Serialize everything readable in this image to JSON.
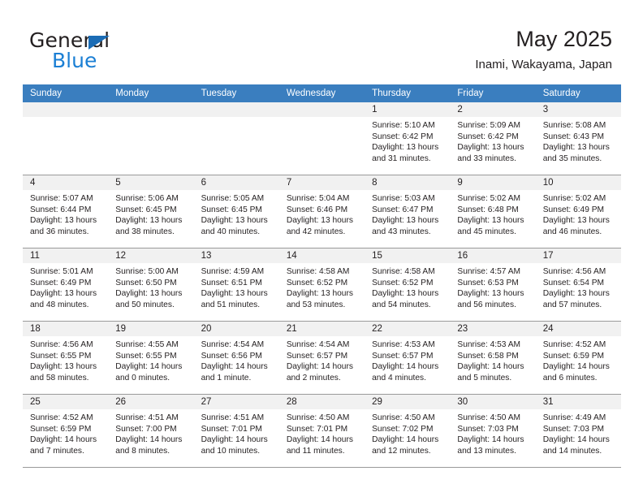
{
  "brand": {
    "name_top": "General",
    "name_bottom": "Blue",
    "accent_color": "#1b7fd4",
    "triangle_color": "#1b6cb5"
  },
  "header": {
    "title": "May 2025",
    "subtitle": "Inami, Wakayama, Japan"
  },
  "calendar": {
    "header_bg": "#3a7ebf",
    "daynum_band_bg": "#f1f1f1",
    "weekdays": [
      "Sunday",
      "Monday",
      "Tuesday",
      "Wednesday",
      "Thursday",
      "Friday",
      "Saturday"
    ],
    "weeks": [
      [
        {
          "day": "",
          "empty": true
        },
        {
          "day": "",
          "empty": true
        },
        {
          "day": "",
          "empty": true
        },
        {
          "day": "",
          "empty": true
        },
        {
          "day": "1",
          "sunrise": "Sunrise: 5:10 AM",
          "sunset": "Sunset: 6:42 PM",
          "daylight1": "Daylight: 13 hours",
          "daylight2": "and 31 minutes."
        },
        {
          "day": "2",
          "sunrise": "Sunrise: 5:09 AM",
          "sunset": "Sunset: 6:42 PM",
          "daylight1": "Daylight: 13 hours",
          "daylight2": "and 33 minutes."
        },
        {
          "day": "3",
          "sunrise": "Sunrise: 5:08 AM",
          "sunset": "Sunset: 6:43 PM",
          "daylight1": "Daylight: 13 hours",
          "daylight2": "and 35 minutes."
        }
      ],
      [
        {
          "day": "4",
          "sunrise": "Sunrise: 5:07 AM",
          "sunset": "Sunset: 6:44 PM",
          "daylight1": "Daylight: 13 hours",
          "daylight2": "and 36 minutes."
        },
        {
          "day": "5",
          "sunrise": "Sunrise: 5:06 AM",
          "sunset": "Sunset: 6:45 PM",
          "daylight1": "Daylight: 13 hours",
          "daylight2": "and 38 minutes."
        },
        {
          "day": "6",
          "sunrise": "Sunrise: 5:05 AM",
          "sunset": "Sunset: 6:45 PM",
          "daylight1": "Daylight: 13 hours",
          "daylight2": "and 40 minutes."
        },
        {
          "day": "7",
          "sunrise": "Sunrise: 5:04 AM",
          "sunset": "Sunset: 6:46 PM",
          "daylight1": "Daylight: 13 hours",
          "daylight2": "and 42 minutes."
        },
        {
          "day": "8",
          "sunrise": "Sunrise: 5:03 AM",
          "sunset": "Sunset: 6:47 PM",
          "daylight1": "Daylight: 13 hours",
          "daylight2": "and 43 minutes."
        },
        {
          "day": "9",
          "sunrise": "Sunrise: 5:02 AM",
          "sunset": "Sunset: 6:48 PM",
          "daylight1": "Daylight: 13 hours",
          "daylight2": "and 45 minutes."
        },
        {
          "day": "10",
          "sunrise": "Sunrise: 5:02 AM",
          "sunset": "Sunset: 6:49 PM",
          "daylight1": "Daylight: 13 hours",
          "daylight2": "and 46 minutes."
        }
      ],
      [
        {
          "day": "11",
          "sunrise": "Sunrise: 5:01 AM",
          "sunset": "Sunset: 6:49 PM",
          "daylight1": "Daylight: 13 hours",
          "daylight2": "and 48 minutes."
        },
        {
          "day": "12",
          "sunrise": "Sunrise: 5:00 AM",
          "sunset": "Sunset: 6:50 PM",
          "daylight1": "Daylight: 13 hours",
          "daylight2": "and 50 minutes."
        },
        {
          "day": "13",
          "sunrise": "Sunrise: 4:59 AM",
          "sunset": "Sunset: 6:51 PM",
          "daylight1": "Daylight: 13 hours",
          "daylight2": "and 51 minutes."
        },
        {
          "day": "14",
          "sunrise": "Sunrise: 4:58 AM",
          "sunset": "Sunset: 6:52 PM",
          "daylight1": "Daylight: 13 hours",
          "daylight2": "and 53 minutes."
        },
        {
          "day": "15",
          "sunrise": "Sunrise: 4:58 AM",
          "sunset": "Sunset: 6:52 PM",
          "daylight1": "Daylight: 13 hours",
          "daylight2": "and 54 minutes."
        },
        {
          "day": "16",
          "sunrise": "Sunrise: 4:57 AM",
          "sunset": "Sunset: 6:53 PM",
          "daylight1": "Daylight: 13 hours",
          "daylight2": "and 56 minutes."
        },
        {
          "day": "17",
          "sunrise": "Sunrise: 4:56 AM",
          "sunset": "Sunset: 6:54 PM",
          "daylight1": "Daylight: 13 hours",
          "daylight2": "and 57 minutes."
        }
      ],
      [
        {
          "day": "18",
          "sunrise": "Sunrise: 4:56 AM",
          "sunset": "Sunset: 6:55 PM",
          "daylight1": "Daylight: 13 hours",
          "daylight2": "and 58 minutes."
        },
        {
          "day": "19",
          "sunrise": "Sunrise: 4:55 AM",
          "sunset": "Sunset: 6:55 PM",
          "daylight1": "Daylight: 14 hours",
          "daylight2": "and 0 minutes."
        },
        {
          "day": "20",
          "sunrise": "Sunrise: 4:54 AM",
          "sunset": "Sunset: 6:56 PM",
          "daylight1": "Daylight: 14 hours",
          "daylight2": "and 1 minute."
        },
        {
          "day": "21",
          "sunrise": "Sunrise: 4:54 AM",
          "sunset": "Sunset: 6:57 PM",
          "daylight1": "Daylight: 14 hours",
          "daylight2": "and 2 minutes."
        },
        {
          "day": "22",
          "sunrise": "Sunrise: 4:53 AM",
          "sunset": "Sunset: 6:57 PM",
          "daylight1": "Daylight: 14 hours",
          "daylight2": "and 4 minutes."
        },
        {
          "day": "23",
          "sunrise": "Sunrise: 4:53 AM",
          "sunset": "Sunset: 6:58 PM",
          "daylight1": "Daylight: 14 hours",
          "daylight2": "and 5 minutes."
        },
        {
          "day": "24",
          "sunrise": "Sunrise: 4:52 AM",
          "sunset": "Sunset: 6:59 PM",
          "daylight1": "Daylight: 14 hours",
          "daylight2": "and 6 minutes."
        }
      ],
      [
        {
          "day": "25",
          "sunrise": "Sunrise: 4:52 AM",
          "sunset": "Sunset: 6:59 PM",
          "daylight1": "Daylight: 14 hours",
          "daylight2": "and 7 minutes."
        },
        {
          "day": "26",
          "sunrise": "Sunrise: 4:51 AM",
          "sunset": "Sunset: 7:00 PM",
          "daylight1": "Daylight: 14 hours",
          "daylight2": "and 8 minutes."
        },
        {
          "day": "27",
          "sunrise": "Sunrise: 4:51 AM",
          "sunset": "Sunset: 7:01 PM",
          "daylight1": "Daylight: 14 hours",
          "daylight2": "and 10 minutes."
        },
        {
          "day": "28",
          "sunrise": "Sunrise: 4:50 AM",
          "sunset": "Sunset: 7:01 PM",
          "daylight1": "Daylight: 14 hours",
          "daylight2": "and 11 minutes."
        },
        {
          "day": "29",
          "sunrise": "Sunrise: 4:50 AM",
          "sunset": "Sunset: 7:02 PM",
          "daylight1": "Daylight: 14 hours",
          "daylight2": "and 12 minutes."
        },
        {
          "day": "30",
          "sunrise": "Sunrise: 4:50 AM",
          "sunset": "Sunset: 7:03 PM",
          "daylight1": "Daylight: 14 hours",
          "daylight2": "and 13 minutes."
        },
        {
          "day": "31",
          "sunrise": "Sunrise: 4:49 AM",
          "sunset": "Sunset: 7:03 PM",
          "daylight1": "Daylight: 14 hours",
          "daylight2": "and 14 minutes."
        }
      ]
    ]
  }
}
